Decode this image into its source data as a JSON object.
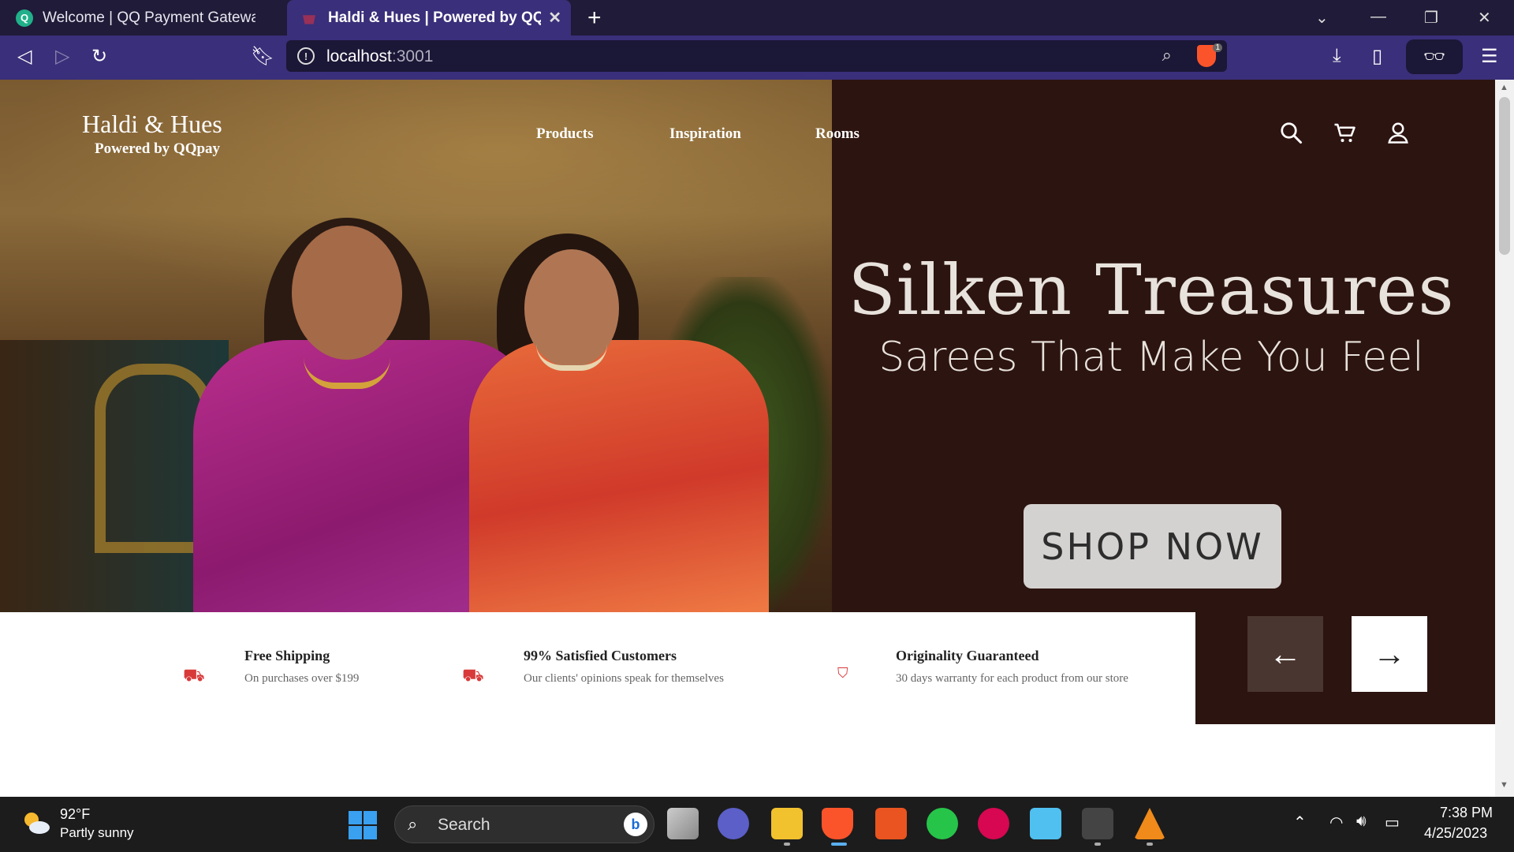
{
  "browser": {
    "tabs": [
      {
        "title": "Welcome | QQ Payment Gateway",
        "favicon": "qq-icon"
      },
      {
        "title": "Haldi & Hues | Powered by QQpay",
        "favicon": "haldi-icon"
      }
    ],
    "url_host": "localhost",
    "url_port": ":3001",
    "shield_count": "1"
  },
  "site": {
    "brand_name": "Haldi & Hues",
    "brand_sub": "Powered by QQpay",
    "nav": [
      "Products",
      "Inspiration",
      "Rooms"
    ],
    "icons": [
      "search-icon",
      "cart-icon",
      "user-icon"
    ]
  },
  "hero": {
    "title": "Silken Treasures",
    "subtitle": "Sarees That Make You Feel",
    "cta": "SHOP NOW"
  },
  "features": [
    {
      "title": "Free Shipping",
      "desc": "On purchases over $199",
      "icon": "truck-icon"
    },
    {
      "title": "99% Satisfied Customers",
      "desc": "Our clients' opinions speak for themselves",
      "icon": "truck-icon"
    },
    {
      "title": "Originality Guaranteed",
      "desc": "30 days warranty for each product from our store",
      "icon": "shield-dollar-icon"
    }
  ],
  "taskbar": {
    "weather_temp": "92°F",
    "weather_desc": "Partly sunny",
    "search_placeholder": "Search",
    "time": "7:38 PM",
    "date": "4/25/2023"
  },
  "colors": {
    "tab_bar": "#1f1b38",
    "toolbar": "#3a2f7a",
    "hero_dark": "#2c1410",
    "accent_red": "#d83a3a"
  }
}
